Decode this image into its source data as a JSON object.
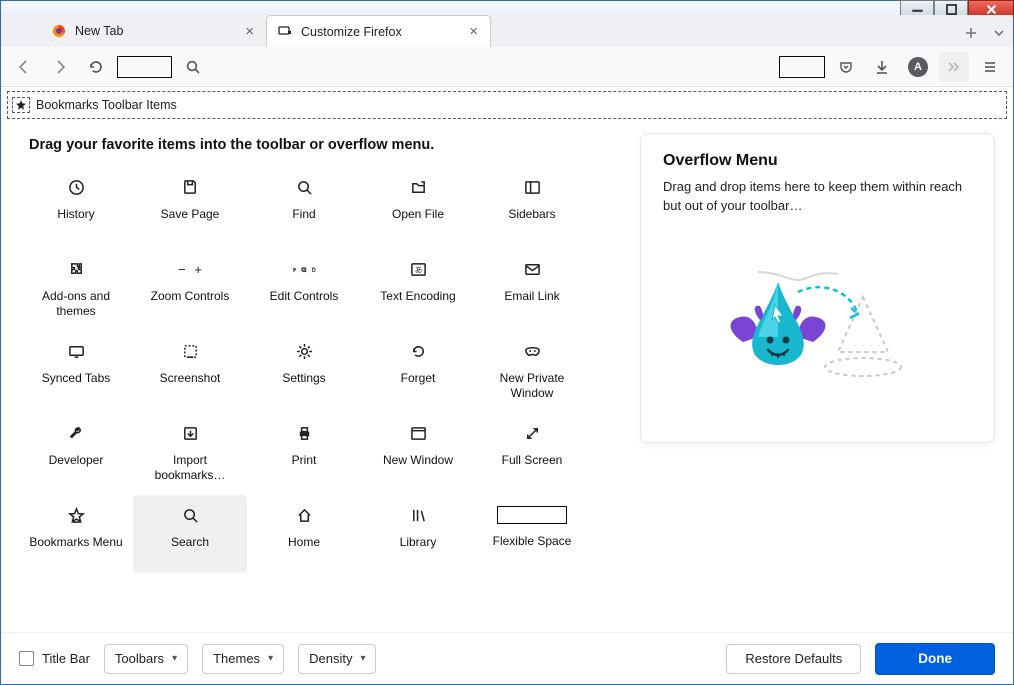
{
  "window": {
    "controls": {
      "minimize": "–",
      "maximize": "▢",
      "close": "✕"
    }
  },
  "tabs": [
    {
      "label": "New Tab",
      "icon": "firefox"
    },
    {
      "label": "Customize Firefox",
      "icon": "brush",
      "active": true
    }
  ],
  "tabstrip": {
    "new_tab_tooltip": "+",
    "all_tabs_tooltip": "˅"
  },
  "bookmarks_zone": {
    "label": "Bookmarks Toolbar Items"
  },
  "customize": {
    "heading": "Drag your favorite items into the toolbar or overflow menu.",
    "items": [
      {
        "id": "history",
        "label": "History"
      },
      {
        "id": "save-page",
        "label": "Save Page"
      },
      {
        "id": "find",
        "label": "Find"
      },
      {
        "id": "open-file",
        "label": "Open File"
      },
      {
        "id": "sidebars",
        "label": "Sidebars"
      },
      {
        "id": "addons",
        "label": "Add-ons and themes"
      },
      {
        "id": "zoom",
        "label": "Zoom Controls"
      },
      {
        "id": "edit",
        "label": "Edit Controls"
      },
      {
        "id": "encoding",
        "label": "Text Encoding"
      },
      {
        "id": "email",
        "label": "Email Link"
      },
      {
        "id": "synced",
        "label": "Synced Tabs"
      },
      {
        "id": "screenshot",
        "label": "Screenshot"
      },
      {
        "id": "settings",
        "label": "Settings"
      },
      {
        "id": "forget",
        "label": "Forget"
      },
      {
        "id": "private",
        "label": "New Private Window"
      },
      {
        "id": "developer",
        "label": "Developer"
      },
      {
        "id": "import",
        "label": "Import bookmarks…"
      },
      {
        "id": "print",
        "label": "Print"
      },
      {
        "id": "new-window",
        "label": "New Window"
      },
      {
        "id": "fullscreen",
        "label": "Full Screen"
      },
      {
        "id": "bookmarks-menu",
        "label": "Bookmarks Menu"
      },
      {
        "id": "search",
        "label": "Search",
        "selected": true
      },
      {
        "id": "home",
        "label": "Home"
      },
      {
        "id": "library",
        "label": "Library"
      },
      {
        "id": "flexspace",
        "label": "Flexible Space"
      }
    ]
  },
  "overflow": {
    "title": "Overflow Menu",
    "description": "Drag and drop items here to keep them within reach but out of your toolbar…"
  },
  "footer": {
    "titlebar_label": "Title Bar",
    "toolbars_label": "Toolbars",
    "themes_label": "Themes",
    "density_label": "Density",
    "restore_label": "Restore Defaults",
    "done_label": "Done"
  },
  "account": {
    "initial": "A"
  }
}
